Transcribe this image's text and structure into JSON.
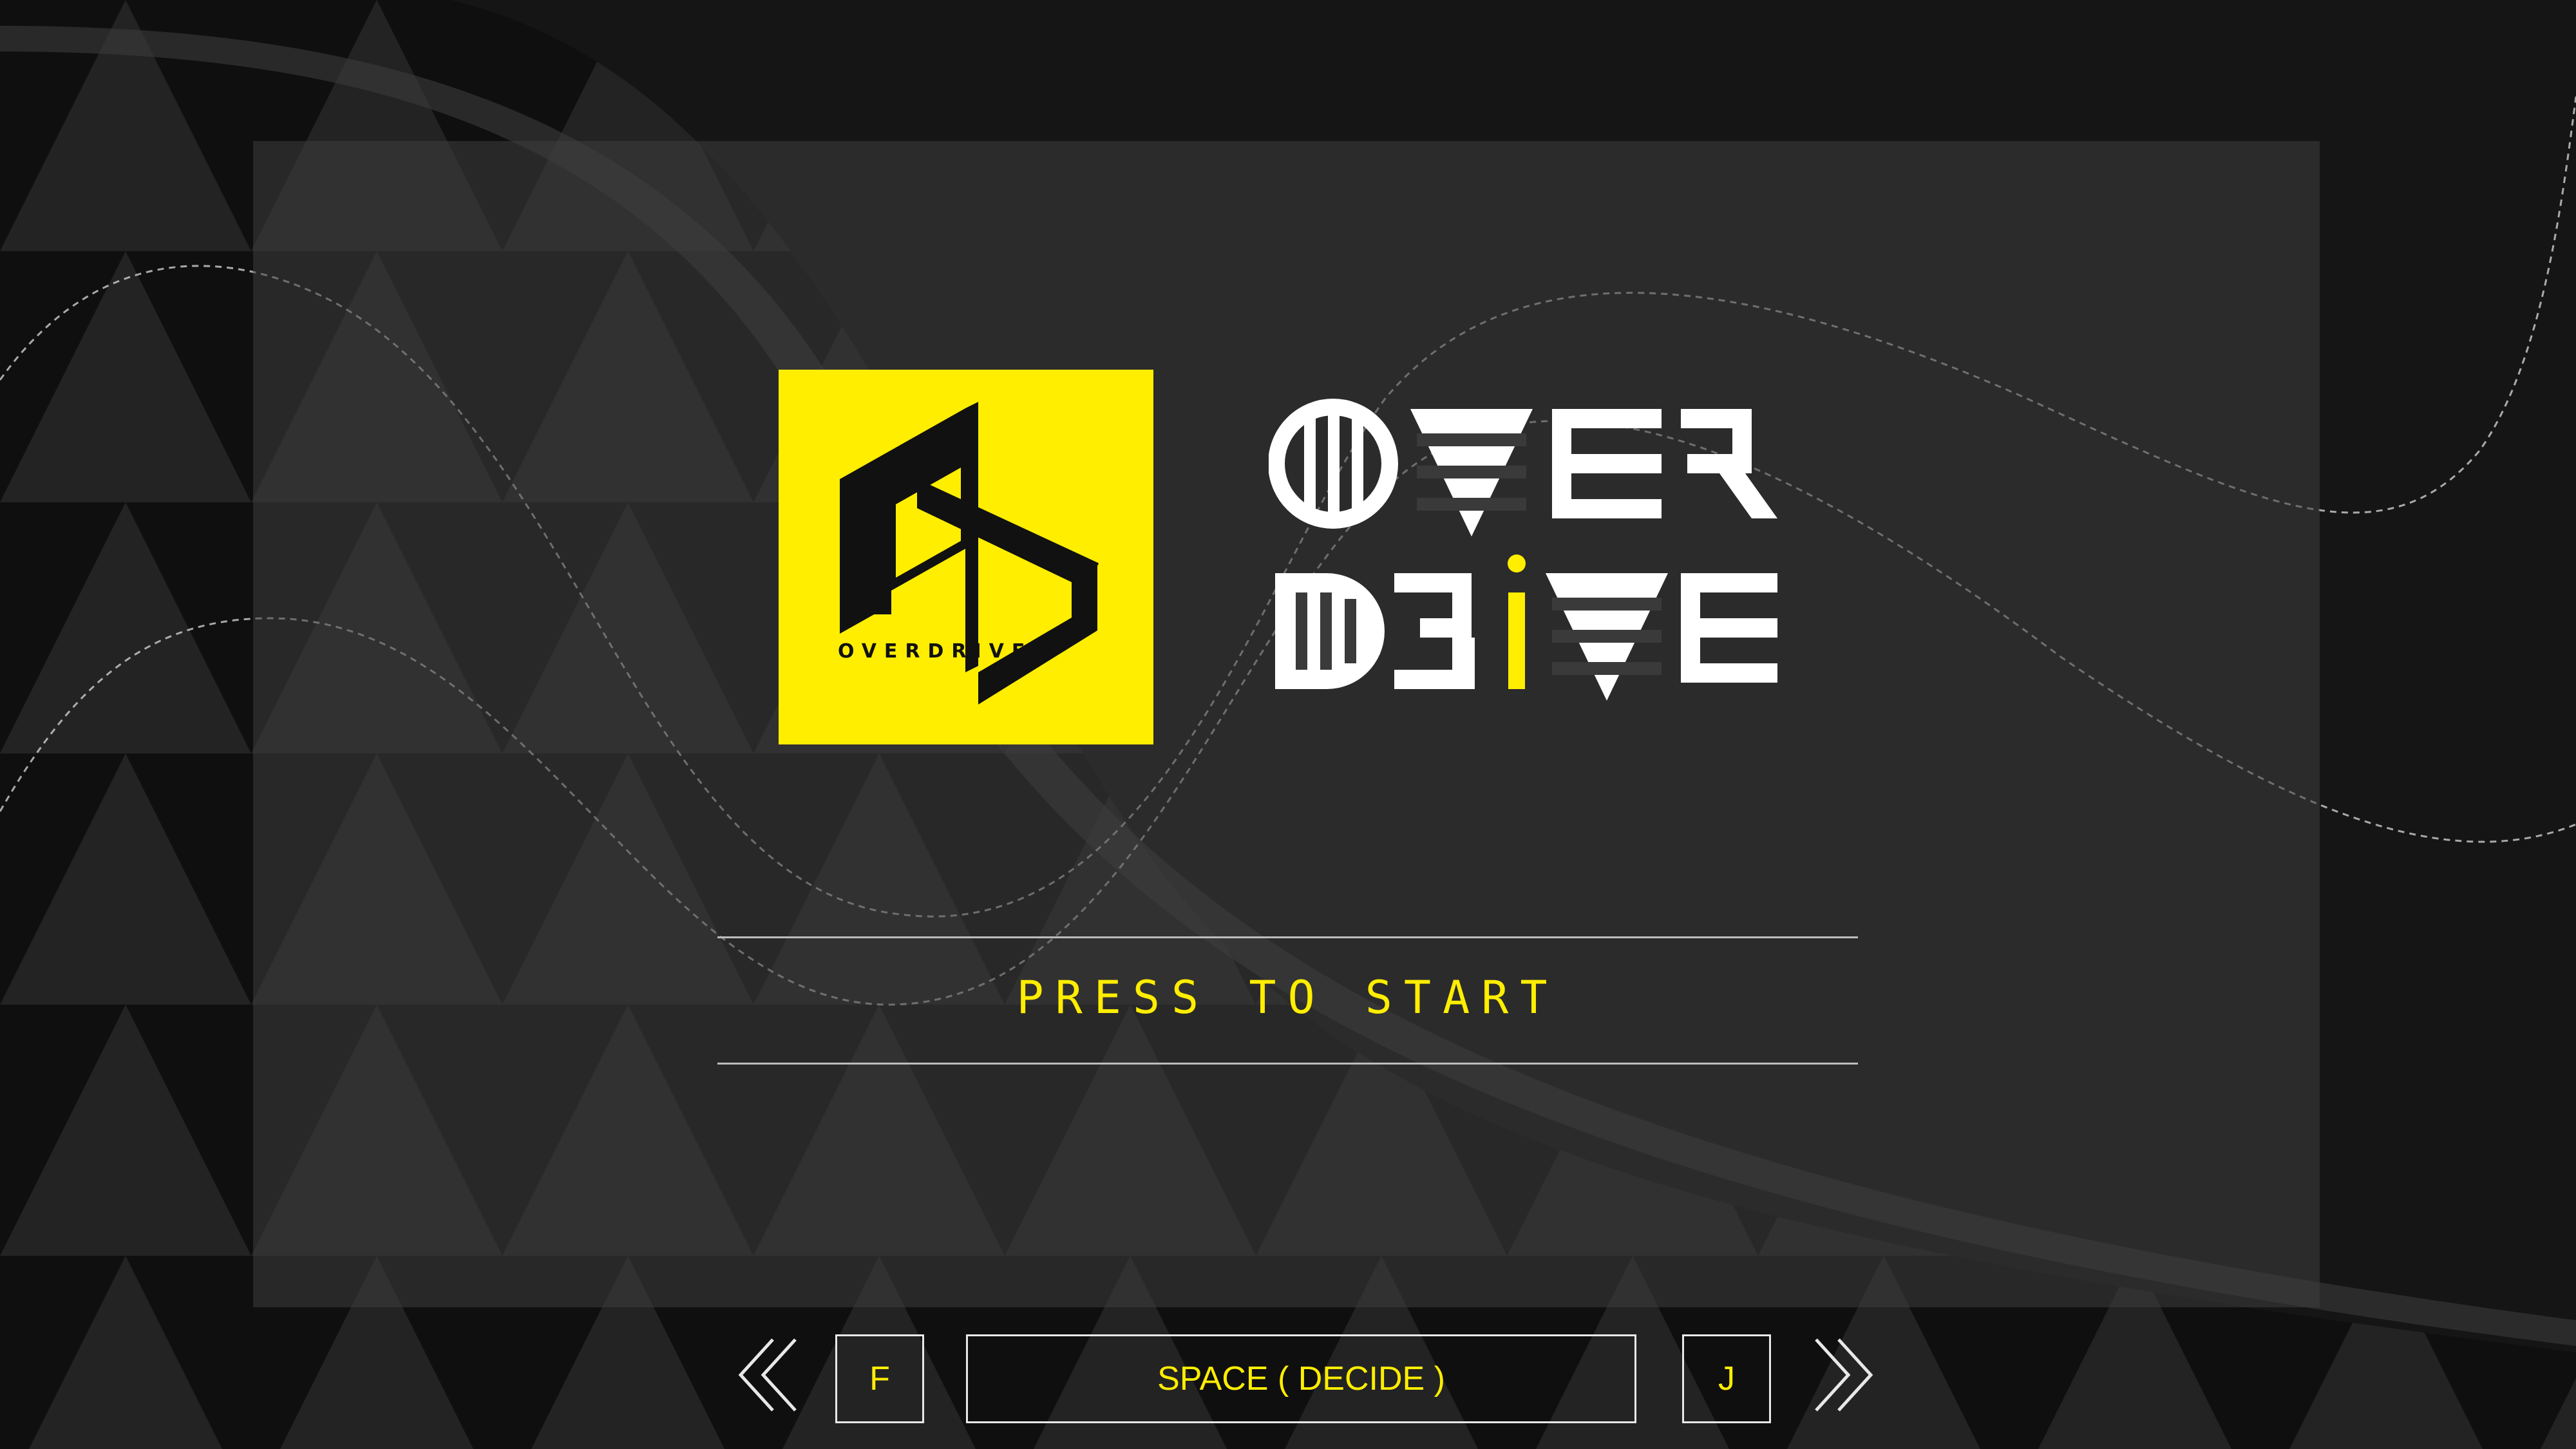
{
  "title": {
    "line1": "OVER",
    "line2": "DRIVE"
  },
  "logo": {
    "icon_name": "overdrive-logo-icon",
    "wordmark": "OVERDRIVE",
    "background": "#FFEE00"
  },
  "prompt": {
    "start_label": "PRESS TO START"
  },
  "controls": {
    "left_icon": "double-chevron-left-icon",
    "left_key": "F",
    "decide_key": "SPACE ( DECIDE )",
    "right_key": "J",
    "right_icon": "double-chevron-right-icon"
  },
  "colors": {
    "accent": "#FFEE00",
    "background": "#141414",
    "text_white": "#FFFFFF"
  }
}
